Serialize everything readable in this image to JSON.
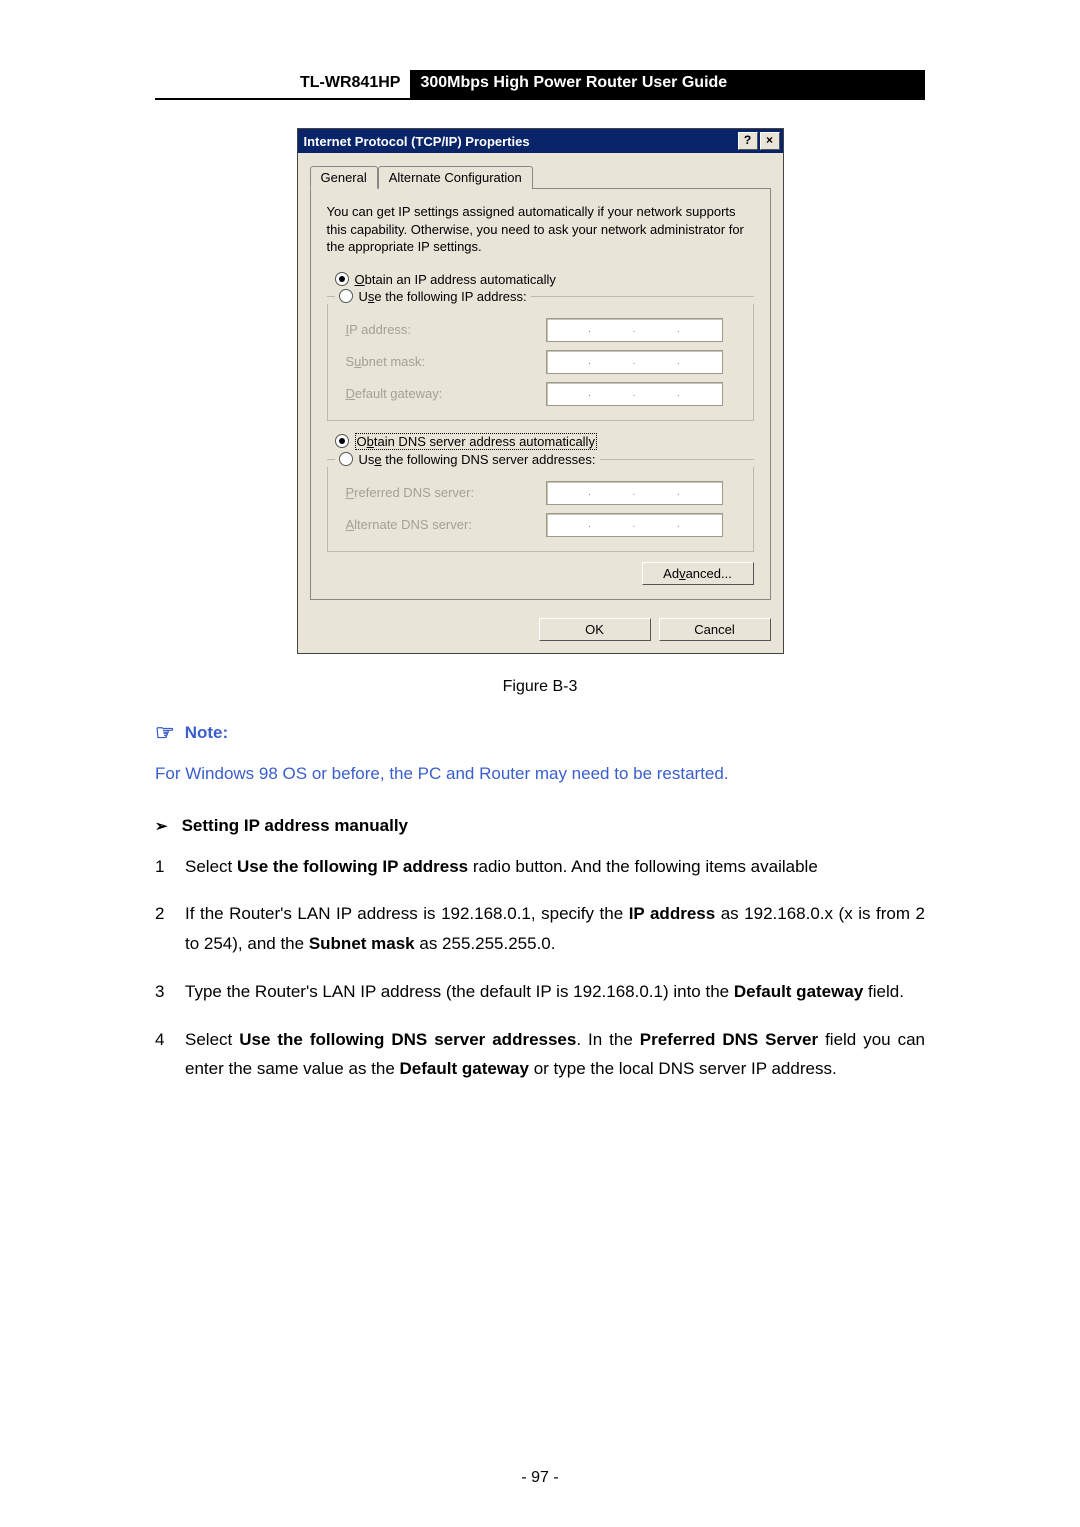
{
  "header": {
    "model": "TL-WR841HP",
    "title": "300Mbps High Power Router User Guide"
  },
  "dialog": {
    "title": "Internet Protocol (TCP/IP) Properties",
    "help_btn": "?",
    "close_btn": "×",
    "tabs": {
      "general": "General",
      "alt": "Alternate Configuration"
    },
    "desc": "You can get IP settings assigned automatically if your network supports this capability. Otherwise, you need to ask your network administrator for the appropriate IP settings.",
    "radio_auto_ip_pre": "O",
    "radio_auto_ip_post": "btain an IP address automatically",
    "radio_use_ip_pre": "U",
    "radio_use_ip_mid": "s",
    "radio_use_ip_post": "e the following IP address:",
    "lbl_ip_pre": "I",
    "lbl_ip_post": "P address:",
    "lbl_sub_pre": "S",
    "lbl_sub_mid": "u",
    "lbl_sub_post": "bnet mask:",
    "lbl_gw_pre": "D",
    "lbl_gw_post": "efault gateway:",
    "radio_auto_dns_pre": "O",
    "radio_auto_dns_mid": "b",
    "radio_auto_dns_post": "tain DNS server address automatically",
    "radio_use_dns_pre": "Us",
    "radio_use_dns_mid": "e",
    "radio_use_dns_post": " the following DNS server addresses:",
    "lbl_pdns_pre": "P",
    "lbl_pdns_post": "referred DNS server:",
    "lbl_adns_pre": "A",
    "lbl_adns_post": "lternate DNS server:",
    "btn_adv_pre": "Ad",
    "btn_adv_mid": "v",
    "btn_adv_post": "anced...",
    "btn_ok": "OK",
    "btn_cancel": "Cancel"
  },
  "caption": "Figure B-3",
  "note": {
    "icon": "☞",
    "label": "Note:",
    "text": "For Windows 98 OS or before, the PC and Router may need to be restarted."
  },
  "section": {
    "chev": "➢",
    "title": "Setting IP address manually"
  },
  "steps": {
    "s1a": "Select ",
    "s1b": "Use the following IP address",
    "s1c": " radio button. And the following items available",
    "s2a": "If the Router's LAN IP address is 192.168.0.1, specify the ",
    "s2b": "IP address",
    "s2c": " as 192.168.0.x (x is from 2 to 254), and the ",
    "s2d": "Subnet mask",
    "s2e": " as 255.255.255.0.",
    "s3a": "Type the Router's LAN IP address (the default IP is 192.168.0.1) into the ",
    "s3b": "Default gateway",
    "s3c": " field.",
    "s4a": "Select ",
    "s4b": "Use the following DNS server addresses",
    "s4c": ".   In the ",
    "s4d": "Preferred DNS Server",
    "s4e": " field you can enter the same value as the ",
    "s4f": "Default gateway",
    "s4g": " or type the local DNS server IP address."
  },
  "pagenum": "- 97 -"
}
